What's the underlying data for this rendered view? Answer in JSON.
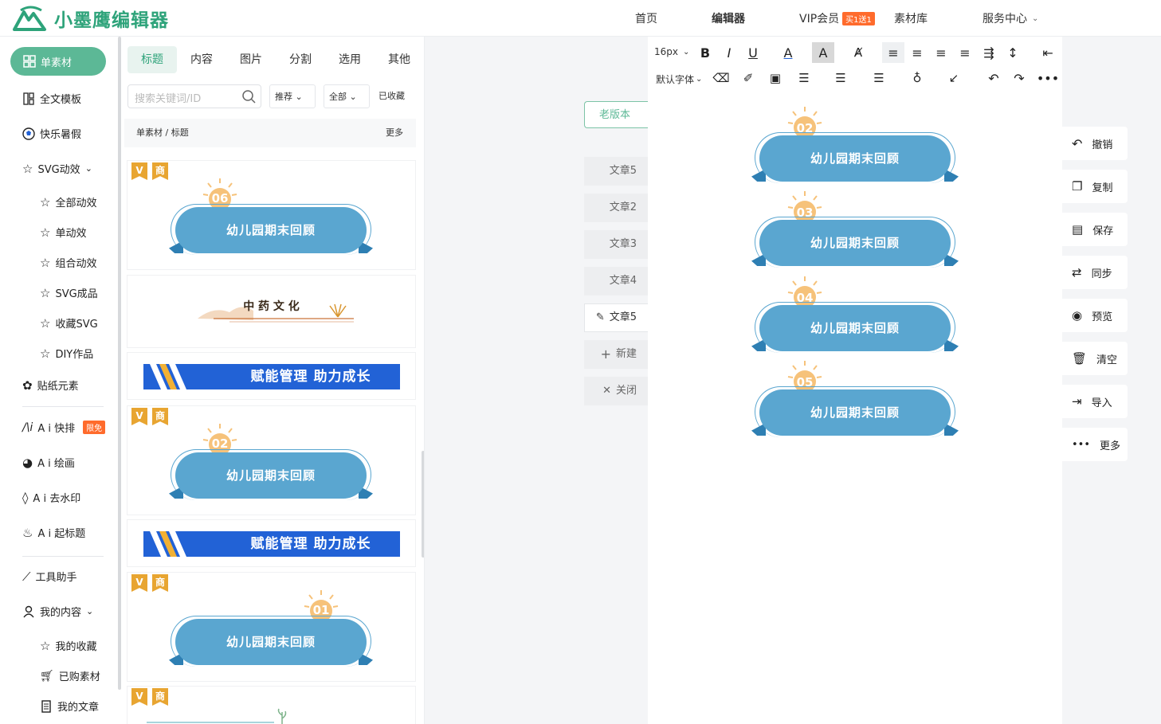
{
  "app": {
    "title": "小墨鹰编辑器"
  },
  "topnav": {
    "home": "首页",
    "editor": "编辑器",
    "vip": "VIP会员",
    "vip_badge": "买1送1",
    "library": "素材库",
    "service": "服务中心"
  },
  "sidebar": {
    "items": [
      {
        "label": "单素材",
        "icon": "grid-icon"
      },
      {
        "label": "全文模板",
        "icon": "template-icon"
      },
      {
        "label": "快乐暑假",
        "icon": "ball-icon"
      },
      {
        "label": "SVG动效",
        "icon": "star-icon"
      },
      {
        "label": "全部动效",
        "icon": "star-icon"
      },
      {
        "label": "单动效",
        "icon": "star-icon"
      },
      {
        "label": "组合动效",
        "icon": "star-icon"
      },
      {
        "label": "SVG成品",
        "icon": "star-icon"
      },
      {
        "label": "收藏SVG",
        "icon": "star-icon"
      },
      {
        "label": "DIY作品",
        "icon": "star-icon"
      },
      {
        "label": "贴纸元素",
        "icon": "puzzle-icon"
      },
      {
        "label": "A i 快排",
        "icon": "ai-icon"
      },
      {
        "label": "A i 绘画",
        "icon": "palette-icon"
      },
      {
        "label": "A i 去水印",
        "icon": "drop-icon"
      },
      {
        "label": "A i 起标题",
        "icon": "flame-icon"
      },
      {
        "label": "工具助手",
        "icon": "ruler-icon"
      },
      {
        "label": "我的内容",
        "icon": "user-icon"
      },
      {
        "label": "我的收藏",
        "icon": "star-icon"
      },
      {
        "label": "已购素材",
        "icon": "cart-icon"
      },
      {
        "label": "我的文章",
        "icon": "doc-icon"
      }
    ],
    "ai_badge": "限免"
  },
  "panel": {
    "tabs": [
      "标题",
      "内容",
      "图片",
      "分割",
      "选用",
      "其他"
    ],
    "search_placeholder": "搜索关键词/ID",
    "sort": "推荐",
    "range": "全部",
    "favorites": "已收藏",
    "breadcrumb": "单素材 / 标题",
    "more": "更多",
    "tag_v": "V",
    "tag_biz": "商",
    "cards": [
      {
        "num": "06",
        "title": "幼儿园期末回顾"
      },
      {
        "title": "中 药 文 化"
      },
      {
        "title": "赋能管理 助力成长"
      },
      {
        "num": "02",
        "title": "幼儿园期末回顾"
      },
      {
        "title": "赋能管理 助力成长"
      },
      {
        "num": "01",
        "title": "幼儿园期末回顾"
      }
    ]
  },
  "articles": {
    "old_version": "老版本",
    "list": [
      "文章5",
      "文章2",
      "文章3",
      "文章4",
      "文章5"
    ],
    "new": "新建",
    "close": "关闭"
  },
  "toolbar": {
    "font_size": "16px",
    "font_family": "默认字体"
  },
  "editor_blocks": [
    {
      "num": "02",
      "title": "幼儿园期末回顾"
    },
    {
      "num": "03",
      "title": "幼儿园期末回顾"
    },
    {
      "num": "04",
      "title": "幼儿园期末回顾"
    },
    {
      "num": "05",
      "title": "幼儿园期末回顾"
    }
  ],
  "actions": [
    {
      "label": "撤销",
      "icon": "undo-icon"
    },
    {
      "label": "复制",
      "icon": "copy-icon"
    },
    {
      "label": "保存",
      "icon": "save-icon"
    },
    {
      "label": "同步",
      "icon": "sync-icon"
    },
    {
      "label": "预览",
      "icon": "eye-icon"
    },
    {
      "label": "清空",
      "icon": "trash-icon"
    },
    {
      "label": "导入",
      "icon": "import-icon"
    },
    {
      "label": "更多",
      "icon": "more-icon"
    }
  ],
  "colors": {
    "brand": "#2ea37a",
    "pill": "#5aa6d0",
    "banner": "#2262d6",
    "sun": "#f6c27a"
  }
}
